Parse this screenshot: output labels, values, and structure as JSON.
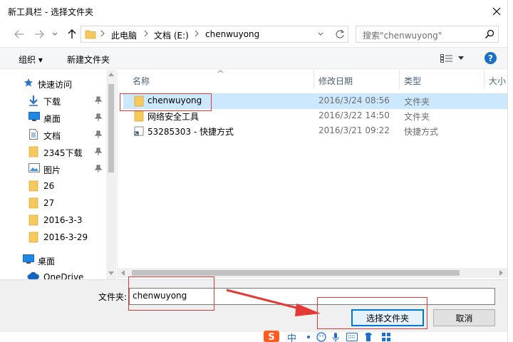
{
  "window": {
    "title": "新工具栏 - 选择文件夹"
  },
  "address": {
    "crumbs": [
      "此电脑",
      "文档 (E:)",
      "chenwuyong"
    ],
    "search_placeholder": "搜索\"chenwuyong\""
  },
  "toolbar": {
    "organize": "组织 ▾",
    "new_folder": "新建文件夹"
  },
  "navigation": {
    "items": [
      {
        "label": "快速访问",
        "icon": "star-icon"
      },
      {
        "label": "下载",
        "icon": "download-icon",
        "pinned": true
      },
      {
        "label": "桌面",
        "icon": "desktop-icon",
        "pinned": true
      },
      {
        "label": "文档",
        "icon": "document-icon",
        "pinned": true
      },
      {
        "label": "2345下载",
        "icon": "folder-icon",
        "pinned": true
      },
      {
        "label": "图片",
        "icon": "picture-icon",
        "pinned": true
      },
      {
        "label": "26",
        "icon": "folder-icon"
      },
      {
        "label": "27",
        "icon": "folder-icon"
      },
      {
        "label": "2016-3-3",
        "icon": "folder-icon"
      },
      {
        "label": "2016-3-29",
        "icon": "folder-icon"
      },
      {
        "label": "桌面",
        "icon": "desktop-icon"
      },
      {
        "label": "OneDrive",
        "icon": "cloud-icon"
      }
    ]
  },
  "columns": {
    "name": "名称",
    "date": "修改日期",
    "type": "类型",
    "size": "大小"
  },
  "files": [
    {
      "name": "chenwuyong",
      "date": "2016/3/24 08:56",
      "type": "文件夹",
      "selected": true,
      "icon": "folder-icon"
    },
    {
      "name": "网络安全工具",
      "date": "2016/3/22 14:50",
      "type": "文件夹",
      "selected": false,
      "icon": "folder-icon"
    },
    {
      "name": "53285303 - 快捷方式",
      "date": "2016/3/21 09:22",
      "type": "快捷方式",
      "selected": false,
      "icon": "shortcut-icon"
    }
  ],
  "footer": {
    "folder_label": "文件夹:",
    "folder_value": "chenwuyong",
    "select_button": "选择文件夹",
    "cancel_button": "取消"
  },
  "taskbar": {
    "ime_label": "中"
  },
  "colors": {
    "accent": "#0078d7",
    "selection": "#cce8ff",
    "annotation": "#e53935",
    "folder": "#f5c95b"
  }
}
